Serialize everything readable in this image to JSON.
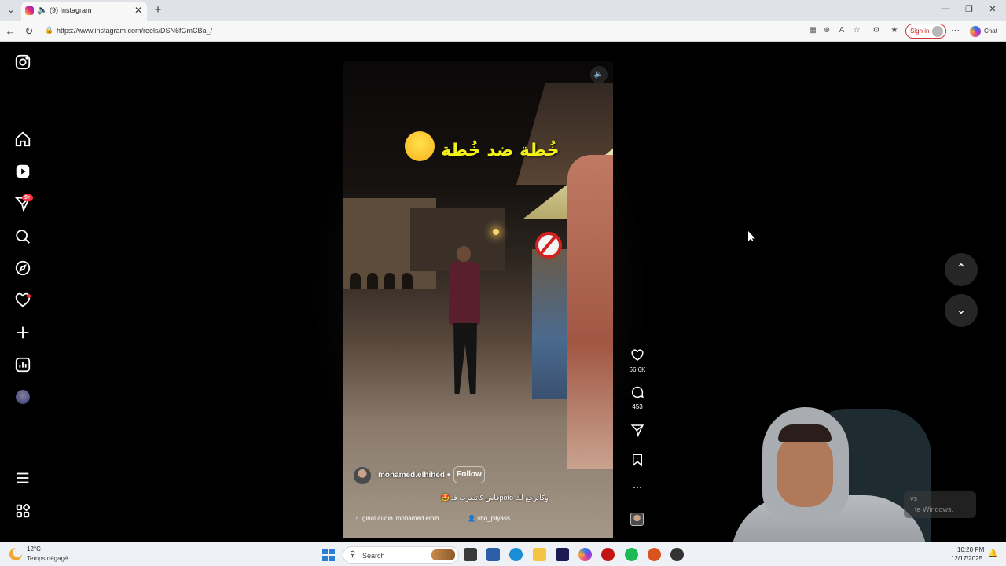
{
  "browser": {
    "tab": {
      "title": "(9) Instagram"
    },
    "url": "https://www.instagram.com/reels/DSN6fGmCBa_/",
    "signin_label": "Sign in",
    "chat_label": "Chat"
  },
  "sidebar": {
    "items": [
      {
        "name": "instagram-logo-icon"
      },
      {
        "name": "home-icon"
      },
      {
        "name": "reels-icon"
      },
      {
        "name": "messages-icon",
        "badge": "9+"
      },
      {
        "name": "search-icon"
      },
      {
        "name": "explore-icon"
      },
      {
        "name": "notifications-icon"
      },
      {
        "name": "create-icon"
      },
      {
        "name": "dashboard-icon"
      },
      {
        "name": "profile-avatar"
      },
      {
        "name": "menu-icon"
      },
      {
        "name": "also-from-meta-icon"
      }
    ]
  },
  "reel": {
    "overlay_text": "خُطة ضد خُطة",
    "owner": "mohamed.elhihed",
    "follow_label": "Follow",
    "separator": "•",
    "caption": "🤩 فاش كاتضرب فـpoto وكاترجع لك",
    "audio": [
      "ginal audio",
      "mohamed.elhih"
    ],
    "tagged_user": "sho_pilyass",
    "likes": "66.6K",
    "comments": "453"
  },
  "toast": {
    "line1": "vs",
    "line2": "te Windows."
  },
  "taskbar": {
    "weather_temp": "12°C",
    "weather_desc": "Temps dégagé",
    "search_label": "Search",
    "time": "10:20 PM",
    "date": "12/17/2025"
  }
}
